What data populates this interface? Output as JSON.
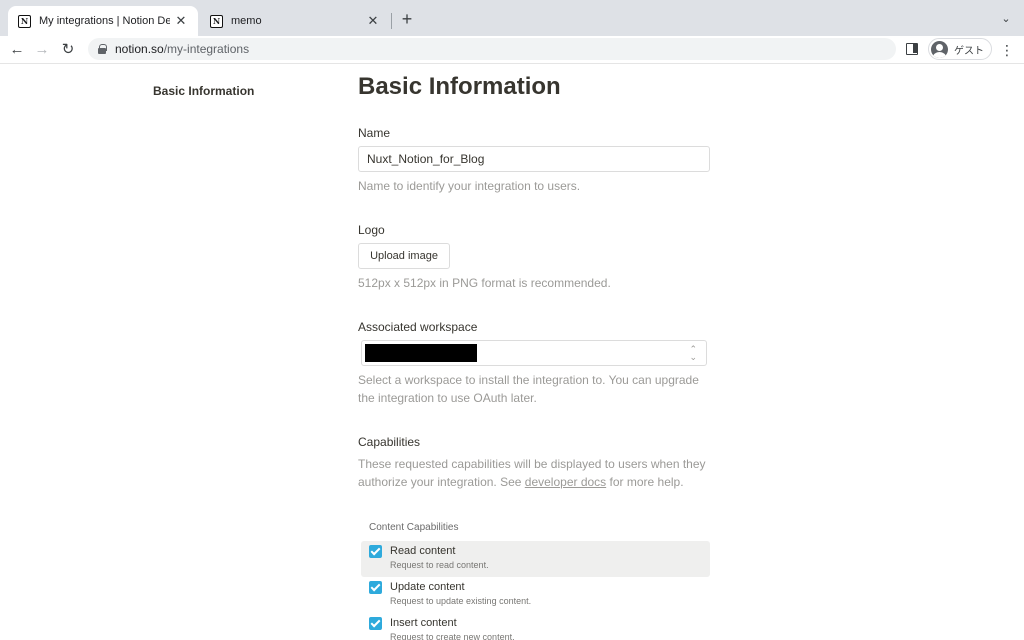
{
  "browser": {
    "tabs": [
      {
        "title": "My integrations | Notion Develo",
        "favicon": "notion-icon",
        "active": true
      },
      {
        "title": "memo",
        "favicon": "notion-icon",
        "active": false
      }
    ],
    "favicon_glyph": "N",
    "close_glyph": "✕",
    "new_tab_glyph": "+",
    "tab_menu_glyph": "⌄",
    "back_glyph": "←",
    "forward_glyph": "→",
    "reload_glyph": "↻",
    "url_host": "notion.so",
    "url_path": "/my-integrations",
    "profile_label": "ゲスト",
    "menu_glyph": "⋮"
  },
  "sidebar": {
    "items": [
      {
        "label": "Basic Information",
        "active": true
      }
    ]
  },
  "main": {
    "title": "Basic Information",
    "name": {
      "label": "Name",
      "value": "Nuxt_Notion_for_Blog",
      "help": "Name to identify your integration to users."
    },
    "logo": {
      "label": "Logo",
      "button": "Upload image",
      "help": "512px x 512px in PNG format is recommended."
    },
    "workspace": {
      "label": "Associated workspace",
      "selected": "",
      "chevron_glyph": "⌃⌄",
      "help": "Select a workspace to install the integration to. You can upgrade the integration to use OAuth later."
    },
    "capabilities": {
      "label": "Capabilities",
      "help_before": "These requested capabilities will be displayed to users when they authorize your integration. See ",
      "help_link": "developer docs",
      "help_after": " for more help.",
      "group_label": "Content Capabilities",
      "items": [
        {
          "title": "Read content",
          "desc": "Request to read content.",
          "checked": true
        },
        {
          "title": "Update content",
          "desc": "Request to update existing content.",
          "checked": true
        },
        {
          "title": "Insert content",
          "desc": "Request to create new content.",
          "checked": true
        }
      ]
    }
  },
  "colors": {
    "accent": "#2eaadc",
    "text": "#37352f",
    "muted": "#9b9a97",
    "highlight_row": "#efefee"
  }
}
